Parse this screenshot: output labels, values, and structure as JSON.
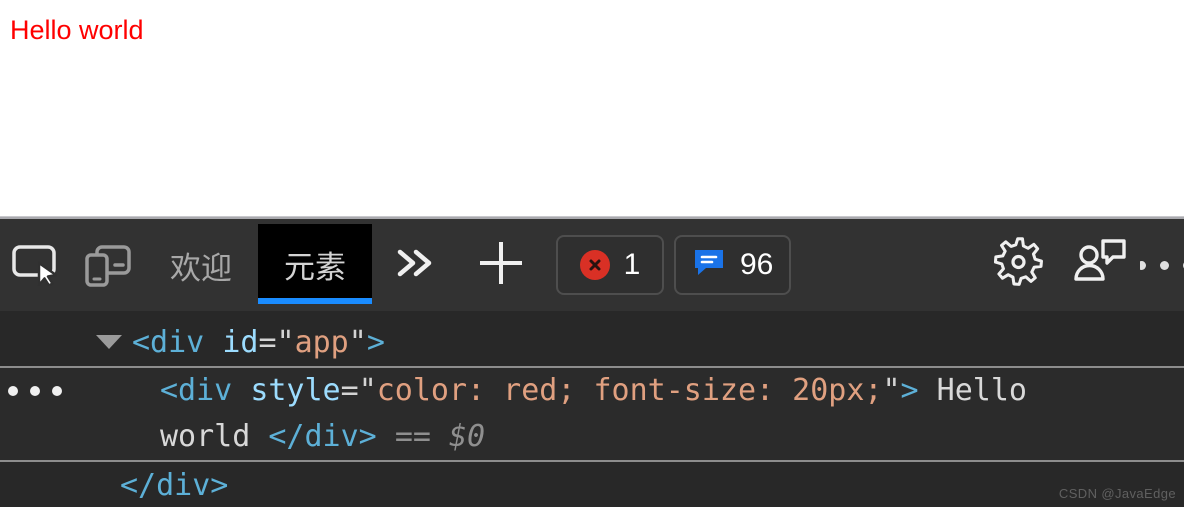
{
  "page": {
    "body_text": "Hello world",
    "body_text_color": "#ff0000",
    "body_text_size": "20px"
  },
  "devtools": {
    "toolbar": {
      "inspect_tooltip": "Inspect element",
      "device_tooltip": "Toggle device toolbar",
      "tabs": [
        {
          "label": "欢迎",
          "active": false
        },
        {
          "label": "元素",
          "active": true
        }
      ],
      "overflow_label": "»",
      "add_tab_label": "+",
      "error_badge": {
        "icon": "error-icon",
        "count": "1",
        "color": "#d93025"
      },
      "message_badge": {
        "icon": "message-icon",
        "count": "96",
        "color": "#1a73e8"
      },
      "settings_label": "gear-icon",
      "feedback_label": "feedback-icon",
      "more_label": "···"
    },
    "dom_tree": {
      "rows": [
        {
          "id": "row-app",
          "twisty": "▼",
          "indent": 1,
          "parts": [
            {
              "t": "tag",
              "v": "<div"
            },
            {
              "t": "space",
              "v": " "
            },
            {
              "t": "attr",
              "v": "id"
            },
            {
              "t": "eq",
              "v": "="
            },
            {
              "t": "quote",
              "v": "\""
            },
            {
              "t": "value",
              "v": "app"
            },
            {
              "t": "quote",
              "v": "\""
            },
            {
              "t": "tag",
              "v": ">"
            }
          ]
        },
        {
          "id": "row-hello-line1",
          "indent": 2,
          "selected": true,
          "ellipsis": "···",
          "parts": [
            {
              "t": "tag",
              "v": "<div"
            },
            {
              "t": "space",
              "v": " "
            },
            {
              "t": "attr",
              "v": "style"
            },
            {
              "t": "eq",
              "v": "="
            },
            {
              "t": "quote",
              "v": "\""
            },
            {
              "t": "value",
              "v": "color: red; font-size: 20px;"
            },
            {
              "t": "quote",
              "v": "\""
            },
            {
              "t": "tag",
              "v": ">"
            },
            {
              "t": "text",
              "v": " Hello"
            }
          ]
        },
        {
          "id": "row-hello-line2",
          "indent": 2,
          "parts": [
            {
              "t": "text",
              "v": "world "
            },
            {
              "t": "tag",
              "v": "</div>"
            },
            {
              "t": "space",
              "v": " "
            },
            {
              "t": "eqeq",
              "v": "=="
            },
            {
              "t": "space",
              "v": " "
            },
            {
              "t": "sel",
              "v": "$0"
            }
          ]
        },
        {
          "id": "row-close-app",
          "indent": 3,
          "parts": [
            {
              "t": "tag",
              "v": "</div>"
            }
          ]
        }
      ]
    },
    "watermark": "CSDN @JavaEdge"
  },
  "colors": {
    "accent_blue": "#1a8cff",
    "error_red": "#d93025",
    "message_blue": "#1a73e8",
    "toolbar_bg": "#323232",
    "panel_bg": "#282828",
    "tag_color": "#5db0d7",
    "attr_color": "#9cdcfe",
    "value_color": "#e0a080"
  }
}
